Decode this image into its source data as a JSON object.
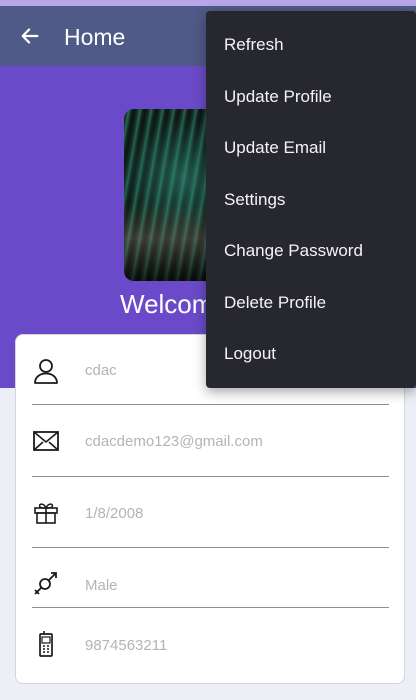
{
  "app_bar": {
    "title": "Home",
    "back_icon": "arrow-left-icon"
  },
  "hero": {
    "welcome_text": "Welcome"
  },
  "profile": {
    "fields": [
      {
        "icon": "user-icon",
        "value": "cdac"
      },
      {
        "icon": "envelope-icon",
        "value": "cdacdemo123@gmail.com"
      },
      {
        "icon": "gift-icon",
        "value": "1/8/2008"
      },
      {
        "icon": "gender-icon",
        "value": "Male"
      },
      {
        "icon": "mobile-phone-icon",
        "value": "9874563211"
      }
    ]
  },
  "menu": {
    "items": [
      {
        "label": "Refresh"
      },
      {
        "label": "Update Profile"
      },
      {
        "label": "Update Email"
      },
      {
        "label": "Settings"
      },
      {
        "label": "Change Password"
      },
      {
        "label": "Delete Profile"
      },
      {
        "label": "Logout"
      }
    ]
  },
  "colors": {
    "app_bar": "#4f5a86",
    "hero": "#6a4ac8",
    "menu_bg": "#27272f",
    "field_text": "#b4b4b8"
  }
}
